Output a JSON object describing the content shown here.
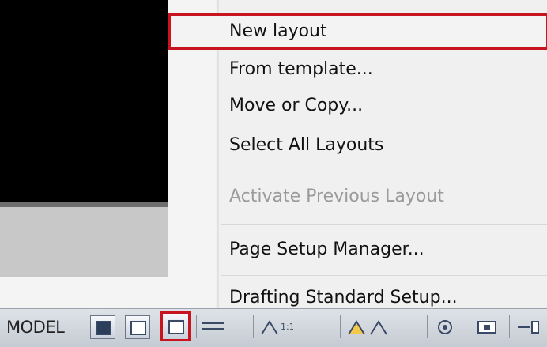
{
  "context_menu": {
    "items": [
      {
        "label": "New layout",
        "state": "selected"
      },
      {
        "label": "From template..."
      },
      {
        "label": "Move or Copy..."
      },
      {
        "label": "Select All Layouts"
      },
      {
        "label": "Activate Previous Layout",
        "state": "disabled"
      },
      {
        "label": "Page Setup Manager..."
      },
      {
        "label": "Drafting Standard Setup..."
      }
    ]
  },
  "status_bar": {
    "model_label": "MODEL",
    "icons": [
      "model-space-icon",
      "layout-icon",
      "quick-view-layouts-icon",
      "quick-view-drawings-icon",
      "annotation-scale-icon",
      "annotation-visibility-icon",
      "workspace-icon",
      "toolbar-lock-icon",
      "status-tray-icon"
    ]
  },
  "colors": {
    "highlight_border": "#c8141e",
    "menu_background": "#f0f0f0",
    "disabled_text": "#9a9a9a"
  }
}
